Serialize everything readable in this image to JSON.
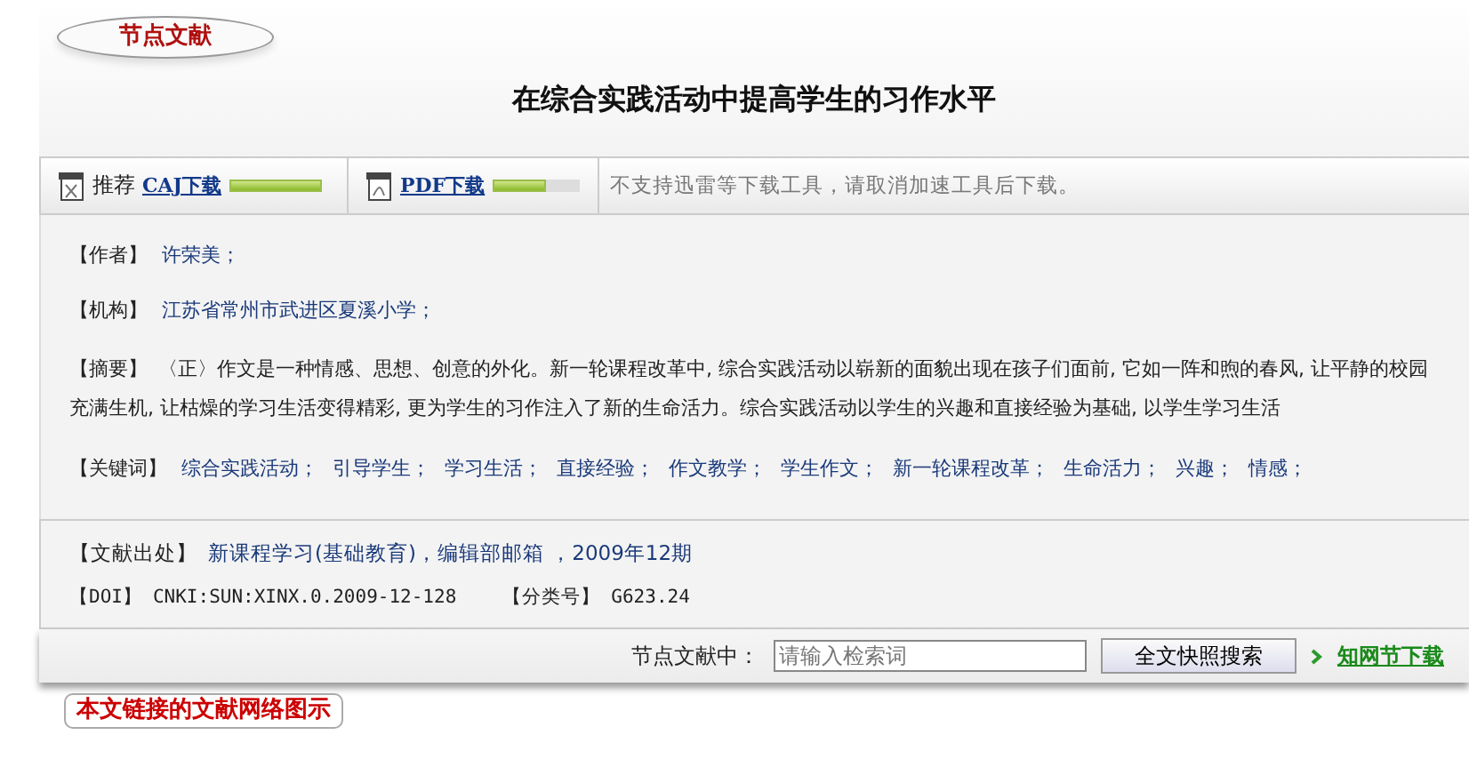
{
  "header": {
    "badge": "节点文献",
    "title": "在综合实践活动中提高学生的习作水平"
  },
  "downloads": [
    {
      "kind": "caj",
      "prefix": "推荐",
      "label": "CAJ下载",
      "level": 1.0
    },
    {
      "kind": "pdf",
      "label": "PDF下载",
      "level": 0.62
    }
  ],
  "download_note": "不支持迅雷等下载工具，请取消加速工具后下载。",
  "fields": [
    {
      "kind": "links",
      "label": "【作者】",
      "values": [
        "许荣美；"
      ]
    },
    {
      "kind": "links",
      "label": "【机构】",
      "values": [
        "江苏省常州市武进区夏溪小学；"
      ]
    },
    {
      "kind": "text",
      "label": "【摘要】",
      "text": "〈正〉作文是一种情感、思想、创意的外化。新一轮课程改革中, 综合实践活动以崭新的面貌出现在孩子们面前, 它如一阵和煦的春风, 让平静的校园充满生机, 让枯燥的学习生活变得精彩, 更为学生的习作注入了新的生命活力。综合实践活动以学生的兴趣和直接经验为基础, 以学生学习生活"
    },
    {
      "kind": "links",
      "label": "【关键词】",
      "values": [
        "综合实践活动；",
        "引导学生；",
        "学习生活；",
        "直接经验；",
        "作文教学；",
        "学生作文；",
        "新一轮课程改革；",
        "生命活力；",
        "兴趣；",
        "情感；"
      ]
    }
  ],
  "source": {
    "label": "【文献出处】",
    "value": "新课程学习(基础教育)，编辑部邮箱 ，2009年12期"
  },
  "doi": {
    "label": "【DOI】",
    "value": "CNKI:SUN:XINX.0.2009-12-128",
    "class_label": "【分类号】",
    "class_value": "G623.24"
  },
  "search": {
    "label": "节点文献中：",
    "placeholder": "请输入检索词",
    "button": "全文快照搜索",
    "link": "知网节下载"
  },
  "next_section": "本文链接的文献网络图示"
}
